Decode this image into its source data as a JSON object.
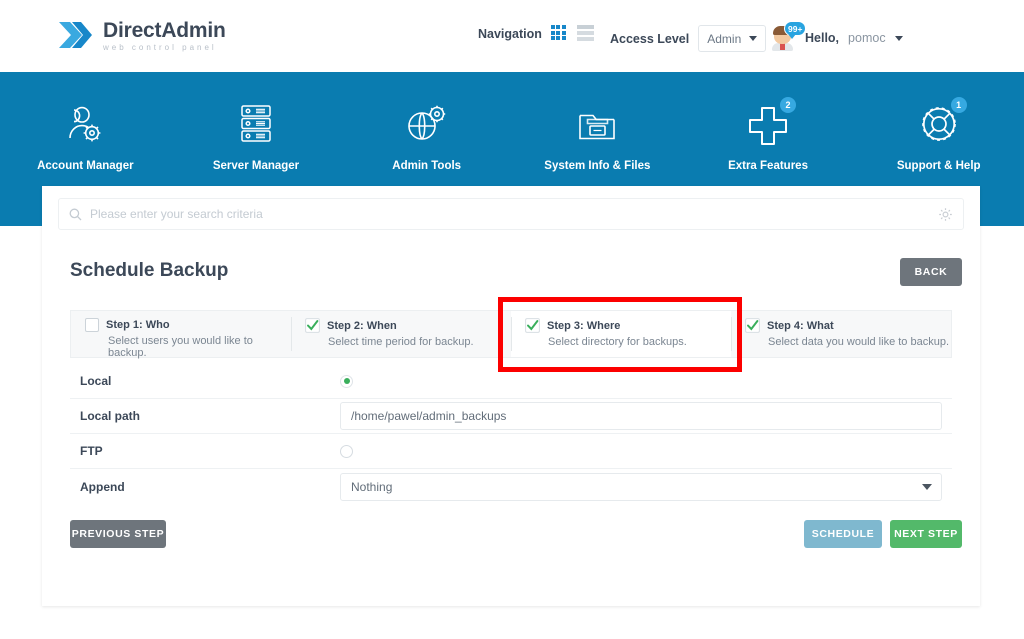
{
  "brand": {
    "name_bold": "Direct",
    "name_light": "Admin",
    "title": "DirectAdmin",
    "tagline": "web control panel"
  },
  "header": {
    "navigation_label": "Navigation",
    "grid_icon": "grid-view-icon",
    "list_icon": "list-view-icon",
    "access_level_label": "Access Level",
    "access_level_value": "Admin",
    "notification_count": "99+",
    "hello_label": "Hello,",
    "username": "pomoc"
  },
  "mainnav": {
    "items": [
      {
        "label": "Account Manager",
        "icon": "users-gear-icon",
        "badge": ""
      },
      {
        "label": "Server Manager",
        "icon": "server-rack-icon",
        "badge": ""
      },
      {
        "label": "Admin Tools",
        "icon": "globe-gear-icon",
        "badge": ""
      },
      {
        "label": "System Info & Files",
        "icon": "folder-files-icon",
        "badge": ""
      },
      {
        "label": "Extra Features",
        "icon": "plus-icon",
        "badge": "2"
      },
      {
        "label": "Support & Help",
        "icon": "lifebuoy-icon",
        "badge": "1"
      }
    ]
  },
  "search": {
    "placeholder": "Please enter your search criteria",
    "value": "",
    "icon": "search-icon",
    "settings_icon": "gear-icon"
  },
  "page": {
    "title": "Schedule Backup",
    "back_button": "BACK"
  },
  "steps": [
    {
      "title": "Step 1: Who",
      "desc": "Select users you would like to backup.",
      "state": "unchecked",
      "active": false
    },
    {
      "title": "Step 2: When",
      "desc": "Select time period for backup.",
      "state": "checked",
      "active": false
    },
    {
      "title": "Step 3: Where",
      "desc": "Select directory for backups.",
      "state": "checked",
      "active": true
    },
    {
      "title": "Step 4: What",
      "desc": "Select data you would like to backup.",
      "state": "checked",
      "active": false
    }
  ],
  "form": {
    "local_label": "Local",
    "local_selected": true,
    "local_path_label": "Local path",
    "local_path_value": "/home/pawel/admin_backups",
    "ftp_label": "FTP",
    "ftp_selected": false,
    "append_label": "Append",
    "append_value": "Nothing"
  },
  "actions": {
    "previous": "PREVIOUS STEP",
    "schedule": "SCHEDULE",
    "next": "NEXT STEP"
  },
  "colors": {
    "brand_blue": "#0a7cb0",
    "accent_blue": "#1787c9",
    "green": "#53b96a",
    "check_green": "#3aaf5c",
    "gray_button": "#6e757c",
    "schedule_blue": "#7fb8cf",
    "highlight_red": "#fc0000",
    "text_dark": "#3c4858"
  }
}
